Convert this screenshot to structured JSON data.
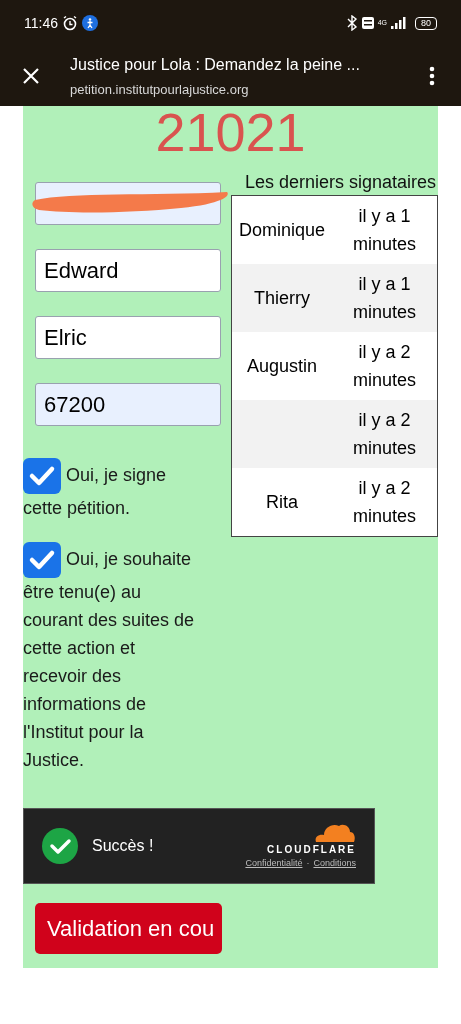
{
  "status_bar": {
    "time": "11:46",
    "network": "4G",
    "battery": "80"
  },
  "browser": {
    "title": "Justice pour Lola : Demandez la peine ...",
    "url": "petition.institutpourlajustice.org"
  },
  "counter": "21021",
  "fields": [
    {
      "redacted": true,
      "autofilled": true
    },
    {
      "value": "Edward",
      "redacted": false,
      "autofilled": false
    },
    {
      "value": "Elric",
      "redacted": false,
      "autofilled": false
    },
    {
      "value": "67200",
      "redacted": false,
      "autofilled": true
    }
  ],
  "checkboxes": [
    {
      "label": "Oui, je signe cette pétition.",
      "checked": true
    },
    {
      "label": "Oui, je souhaite être tenu(e) au courant des suites de cette action et recevoir des informations de l'Institut pour la Justice.",
      "checked": true
    }
  ],
  "signers": {
    "title": "Les derniers signataires",
    "rows": [
      {
        "name": "Dominique",
        "time": "il y a 1 minutes"
      },
      {
        "name": "Thierry",
        "time": "il y a 1 minutes"
      },
      {
        "name": "Augustin",
        "time": "il y a 2 minutes"
      },
      {
        "time": "il y a 2 minutes"
      },
      {
        "name": "Rita",
        "time": "il y a 2 minutes"
      }
    ]
  },
  "captcha": {
    "message": "Succès !",
    "brand": "CLOUDFLARE",
    "links": [
      "Confidentialité",
      "Conditions"
    ],
    "separator": "·"
  },
  "submit": {
    "label": "Validation en cou"
  }
}
